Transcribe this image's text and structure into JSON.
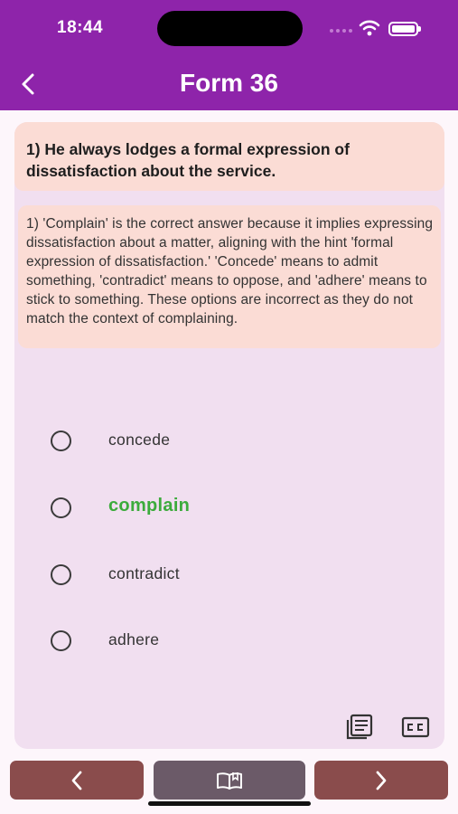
{
  "status_bar": {
    "time": "18:44"
  },
  "app_bar": {
    "title": "Form 36"
  },
  "question": {
    "text": "1) He always lodges a formal expression of dissatisfaction about the service."
  },
  "explanation": {
    "text": "1) 'Complain' is the correct answer because it implies expressing dissatisfaction about a matter, aligning with the hint 'formal expression of dissatisfaction.' 'Concede' means to admit something, 'contradict' means to oppose, and 'adhere' means to stick to something. These options are incorrect as they do not match the context of complaining."
  },
  "options": [
    {
      "label": "concede",
      "correct": false
    },
    {
      "label": "complain",
      "correct": true
    },
    {
      "label": "contradict",
      "correct": false
    },
    {
      "label": "adhere",
      "correct": false
    }
  ],
  "colors": {
    "app_bar": "#8e24aa",
    "card": "#f1dff0",
    "question_bg": "#fbdcd5",
    "correct": "#3cab3c",
    "nav_button": "#8a4c4c",
    "center_button": "#6b5a68"
  },
  "icons": {
    "back": "chevron-left-icon",
    "notes": "notes-icon",
    "captions": "cc-icon",
    "prev": "chevron-left-icon",
    "book": "open-book-icon",
    "next": "chevron-right-icon"
  }
}
